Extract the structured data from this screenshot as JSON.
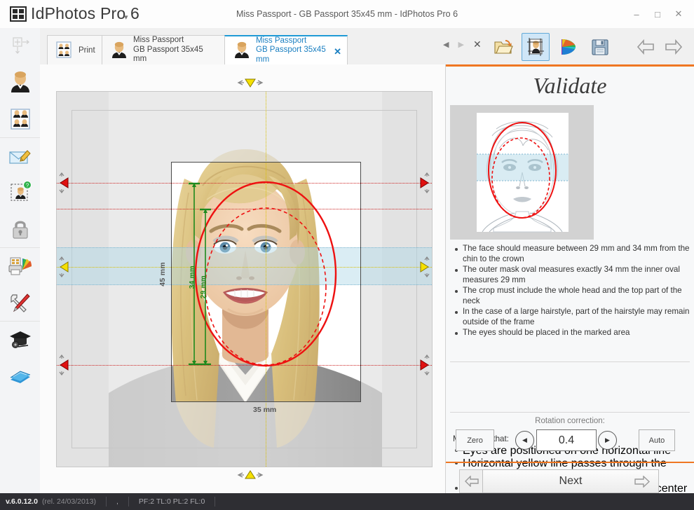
{
  "window": {
    "app_name": "IdPhotos Pro 6",
    "app_caret": "▾",
    "title": "Miss Passport - GB Passport 35x45 mm - IdPhotos Pro 6",
    "minimize": "–",
    "maximize": "□",
    "close": "✕"
  },
  "sidebar": {
    "items": [
      {
        "name": "add-new-icon",
        "label": "Add New"
      },
      {
        "name": "person-icon",
        "label": "Person"
      },
      {
        "name": "photo-sheet-icon",
        "label": "Photo Sheet"
      },
      {
        "name": "email-edit-icon",
        "label": "Email"
      },
      {
        "name": "crop-help-icon",
        "label": "Crop Help"
      },
      {
        "name": "lock-icon",
        "label": "Lock"
      },
      {
        "name": "printer-color-icon",
        "label": "Printer Color"
      },
      {
        "name": "tools-icon",
        "label": "Tools"
      },
      {
        "name": "tutorial-icon",
        "label": "Tutorial"
      },
      {
        "name": "manual-icon",
        "label": "Manual"
      }
    ]
  },
  "tabs": {
    "print_label": "Print",
    "items": [
      {
        "line1": "Miss Passport",
        "line2": "GB Passport 35x45 mm",
        "active": false,
        "closable": false
      },
      {
        "line1": "Miss Passport",
        "line2": "GB Passport 35x45 mm",
        "active": true,
        "closable": true
      }
    ],
    "close_glyph": "✕",
    "nav_prev": "◀",
    "nav_next": "▶",
    "nav_close": "✕"
  },
  "toolbar": {
    "buttons": [
      {
        "name": "open-folder-button",
        "label": "Open"
      },
      {
        "name": "crop-photo-button",
        "label": "Crop Photo",
        "selected": true
      },
      {
        "name": "color-adjust-button",
        "label": "Color"
      },
      {
        "name": "save-button",
        "label": "Save"
      }
    ],
    "back_arrow": "Back",
    "forward_arrow": "Forward"
  },
  "canvas": {
    "height_label": "45 mm",
    "width_label": "35 mm",
    "outer_oval_label": "34 mm",
    "inner_oval_label": "29 mm",
    "colors": {
      "crop_guide_red": "#cc2222",
      "center_guide_yellow": "#d8c000",
      "oval_red": "#ee1111",
      "measure_green": "#1d8a1d",
      "eye_band": "#add6e7"
    }
  },
  "validate": {
    "title": "Validate",
    "accent_color": "#ef7722",
    "pad": {
      "up": "▲",
      "down": "▼",
      "left": "◀",
      "right": "▶"
    },
    "zoom_in": "+",
    "zoom_out": "−",
    "rules": [
      "The face should measure between 29 mm and 34 mm from the chin to the crown",
      "The outer mask oval measures exactly 34 mm the inner oval measures 29 mm",
      "The crop must include the whole head and the top part of the neck",
      "In the case of a large hairstyle, part of the hairstyle may remain outside of the frame",
      "The eyes should be placed in the marked area"
    ],
    "make_sure_heading": "Make sure that:",
    "make_sure": [
      "Eyes are positioned on one horizontal line",
      "Horizontal yellow line passes through the center of the eyes",
      "Vertical yellow line passes through the center of the face"
    ],
    "rotation_label": "Rotation correction:",
    "rotation_value": "0.4",
    "zero_label": "Zero",
    "auto_label": "Auto",
    "rot_left": "◀",
    "rot_right": "▶",
    "next_label": "Next",
    "next_arrow": "⇨",
    "prev_arrow": "⇦"
  },
  "status": {
    "version": "v.6.0.12.0",
    "release": "(rel. 24/03/2013)",
    "middle": ",",
    "counters": "PF:2 TL:0 PL:2 FL:0"
  }
}
